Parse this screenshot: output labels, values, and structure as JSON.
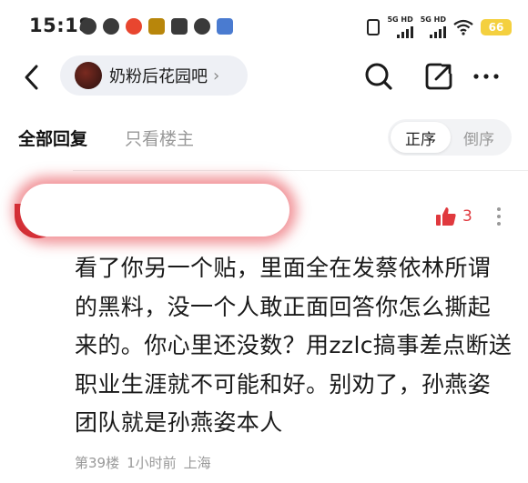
{
  "status_bar": {
    "time": "15:18",
    "signal1_label": "5G HD",
    "signal2_label": "5G HD",
    "battery": "66",
    "battery_color": "#f4d03f"
  },
  "navbar": {
    "forum_name": "奶粉后花园吧",
    "chevron": "›",
    "icons": [
      "back-arrow-icon",
      "search-icon",
      "share-icon",
      "more-icon"
    ]
  },
  "tabs": {
    "all_replies": "全部回复",
    "op_only": "只看楼主",
    "order_asc": "正序",
    "order_desc": "倒序"
  },
  "post": {
    "like_count": "3",
    "like_color": "#e0393e",
    "content": "看了你另一个贴，里面全在发蔡依林所谓的黑料，没一个人敢正面回答你怎么撕起来的。你心里还没数？用zzlc搞事差点断送职业生涯就不可能和好。别劝了，孙燕姿团队就是孙燕姿本人",
    "floor": "第39楼",
    "time": "1小时前",
    "location": "上海"
  }
}
